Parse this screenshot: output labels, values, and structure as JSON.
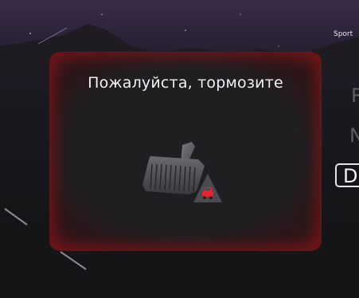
{
  "mode": {
    "label": "Sport"
  },
  "gears": {
    "items": [
      "R",
      "N",
      "D"
    ],
    "selected": "D"
  },
  "alert": {
    "message": "Пожалуйста, тормозите",
    "icon": "brake-pedal-icon",
    "badge_icon": "car-warning-icon",
    "accent_color": "#c8202a"
  },
  "colors": {
    "background": "#141416",
    "sky": "#3a2c48",
    "modal_glow": "#a01418",
    "warning_red": "#e8232e",
    "gear_inactive": "#5e5e66",
    "gear_active": "#f2f2f6"
  }
}
